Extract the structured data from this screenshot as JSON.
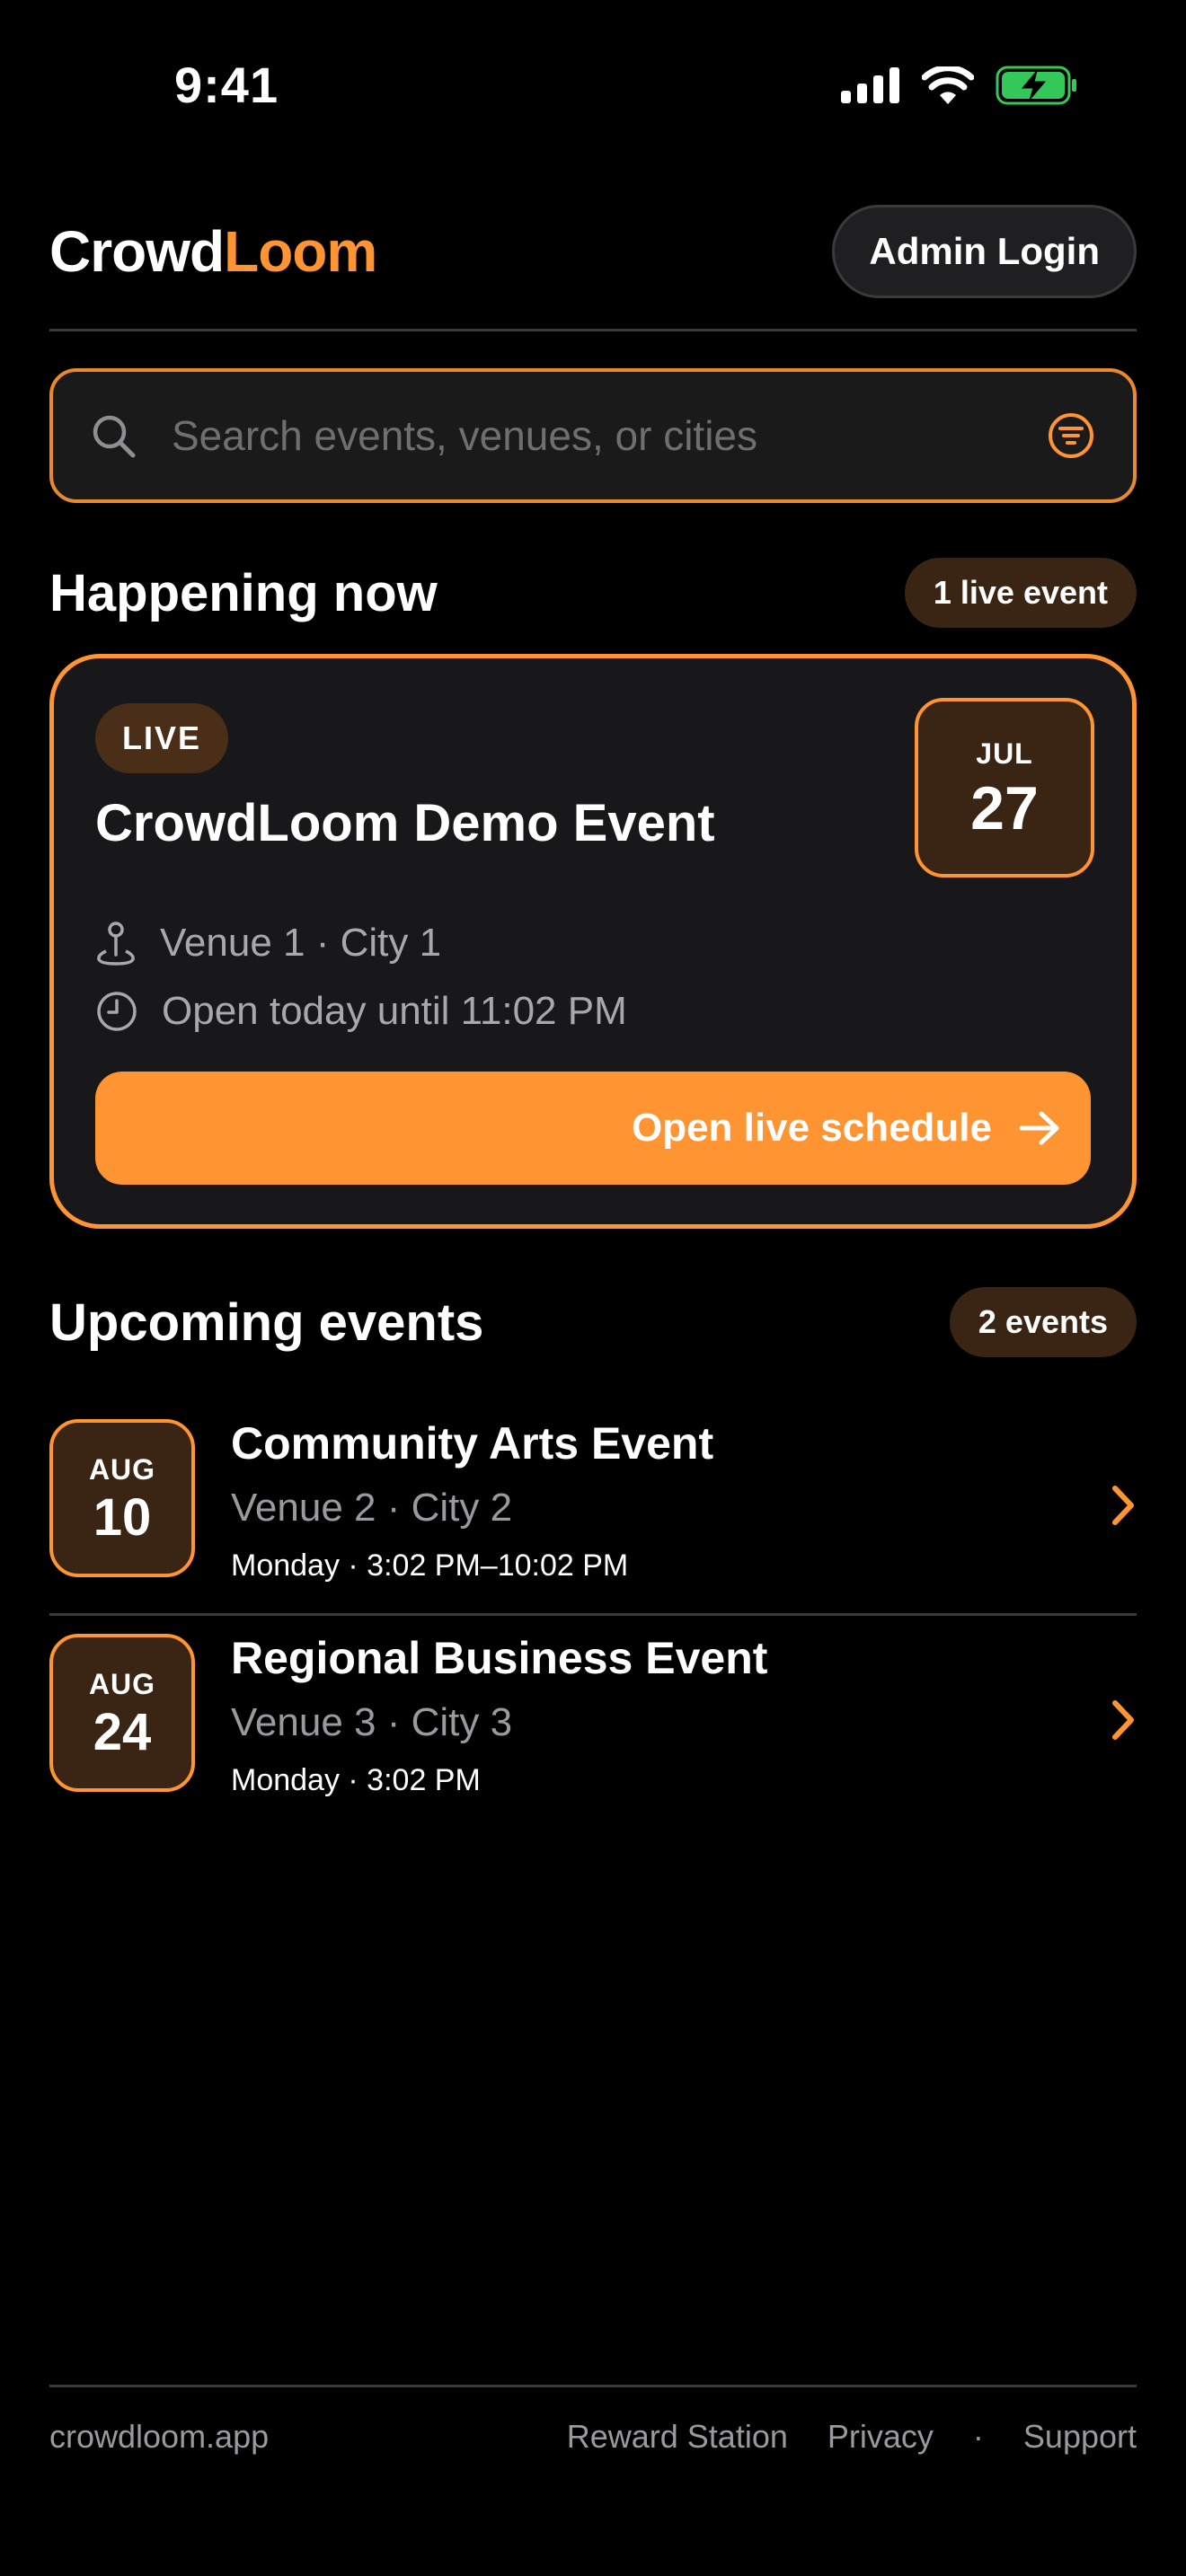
{
  "status_bar": {
    "time": "9:41"
  },
  "header": {
    "brand_part1": "Crowd",
    "brand_part2": "Loom",
    "admin_button": "Admin Login"
  },
  "search": {
    "placeholder": "Search events, venues, or cities"
  },
  "happening_now": {
    "title": "Happening now",
    "count_pill": "1 live event",
    "card": {
      "badge": "LIVE",
      "title": "CrowdLoom Demo Event",
      "date_month": "JUL",
      "date_day": "27",
      "venue": "Venue 1 · City 1",
      "hours": "Open today until 11:02 PM",
      "cta": "Open live schedule"
    }
  },
  "upcoming": {
    "title": "Upcoming events",
    "count_pill": "2 events",
    "items": [
      {
        "month": "AUG",
        "day": "10",
        "title": "Community Arts Event",
        "venue": "Venue 2 · City 2",
        "time": "Monday · 3:02 PM–10:02 PM"
      },
      {
        "month": "AUG",
        "day": "24",
        "title": "Regional Business Event",
        "venue": "Venue 3 · City 3",
        "time": "Monday · 3:02 PM"
      }
    ]
  },
  "footer": {
    "site": "crowdloom.app",
    "links": [
      "Reward Station",
      "Privacy",
      "·",
      "Support"
    ]
  },
  "colors": {
    "accent": "#FF9433",
    "background": "#000000",
    "card": "#18181a",
    "battery": "#34C759"
  },
  "icons": [
    "signal-icon",
    "wifi-icon",
    "battery-charging-icon",
    "search-icon",
    "filter-icon",
    "location-pin-icon",
    "clock-icon",
    "arrow-right-icon",
    "chevron-right-icon"
  ]
}
